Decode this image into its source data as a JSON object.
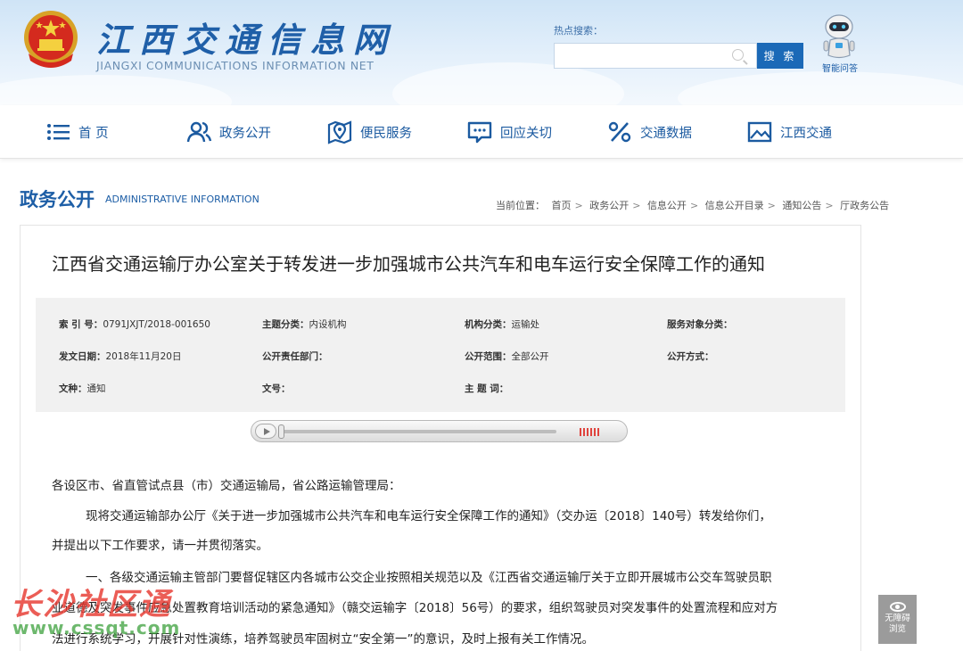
{
  "header": {
    "site_title": "江西交通信息网",
    "site_subtitle": "JIANGXI COMMUNICATIONS INFORMATION NET",
    "hot_search_label": "热点搜索：",
    "search_placeholder": "",
    "search_button": "搜 索",
    "robot_label": "智能问答"
  },
  "nav": {
    "items": [
      {
        "label": "首 页",
        "icon": "list-icon"
      },
      {
        "label": "政务公开",
        "icon": "people-icon"
      },
      {
        "label": "便民服务",
        "icon": "map-pin-icon"
      },
      {
        "label": "回应关切",
        "icon": "chat-icon"
      },
      {
        "label": "交通数据",
        "icon": "percent-icon"
      },
      {
        "label": "江西交通",
        "icon": "picture-icon"
      }
    ]
  },
  "section": {
    "title": "政务公开",
    "subtitle": "ADMINISTRATIVE INFORMATION"
  },
  "breadcrumb": {
    "label": "当前位置：",
    "items": [
      "首页",
      "政务公开",
      "信息公开",
      "信息公开目录",
      "通知公告",
      "厅政务公告"
    ]
  },
  "document": {
    "title": "江西省交通运输厅办公室关于转发进一步加强城市公共汽车和电车运行安全保障工作的通知",
    "meta": {
      "index_label": "索 引 号：",
      "index_value": "0791JXJT/2018-001650",
      "topic_label": "主题分类：",
      "topic_value": "内设机构",
      "org_label": "机构分类：",
      "org_value": "运输处",
      "audience_label": "服务对象分类：",
      "audience_value": "",
      "date_label": "发文日期：",
      "date_value": "2018年11月20日",
      "dept_label": "公开责任部门：",
      "dept_value": "",
      "scope_label": "公开范围：",
      "scope_value": "全部公开",
      "mode_label": "公开方式：",
      "mode_value": "",
      "genre_label": "文种：",
      "genre_value": "通知",
      "docno_label": "文号：",
      "docno_value": "",
      "keyword_label": "主 题 词：",
      "keyword_value": ""
    },
    "player": {
      "progress": 0
    },
    "paragraphs": [
      "各设区市、省直管试点县（市）交通运输局，省公路运输管理局：",
      "现将交通运输部办公厅《关于进一步加强城市公共汽车和电车运行安全保障工作的通知》（交办运〔2018〕140号）转发给你们，",
      "并提出以下工作要求，请一并贯彻落实。",
      "一、各级交通运输主管部门要督促辖区内各城市公交企业按照相关规范以及《江西省交通运输厅关于立即开展城市公交车驾驶员职",
      "业道德及突发事件应急处置教育培训活动的紧急通知》（赣交运输字〔2018〕56号）的要求，组织驾驶员对突发事件的处置流程和应对方",
      "法进行系统学习，开展针对性演练，培养驾驶员牢固树立“安全第一”的意识，及时上报有关工作情况。"
    ]
  },
  "watermark": {
    "cn": "长沙社区通",
    "url": "www.cssqt.com"
  },
  "accessibility": {
    "label_1": "无障碍",
    "label_2": "浏览"
  }
}
